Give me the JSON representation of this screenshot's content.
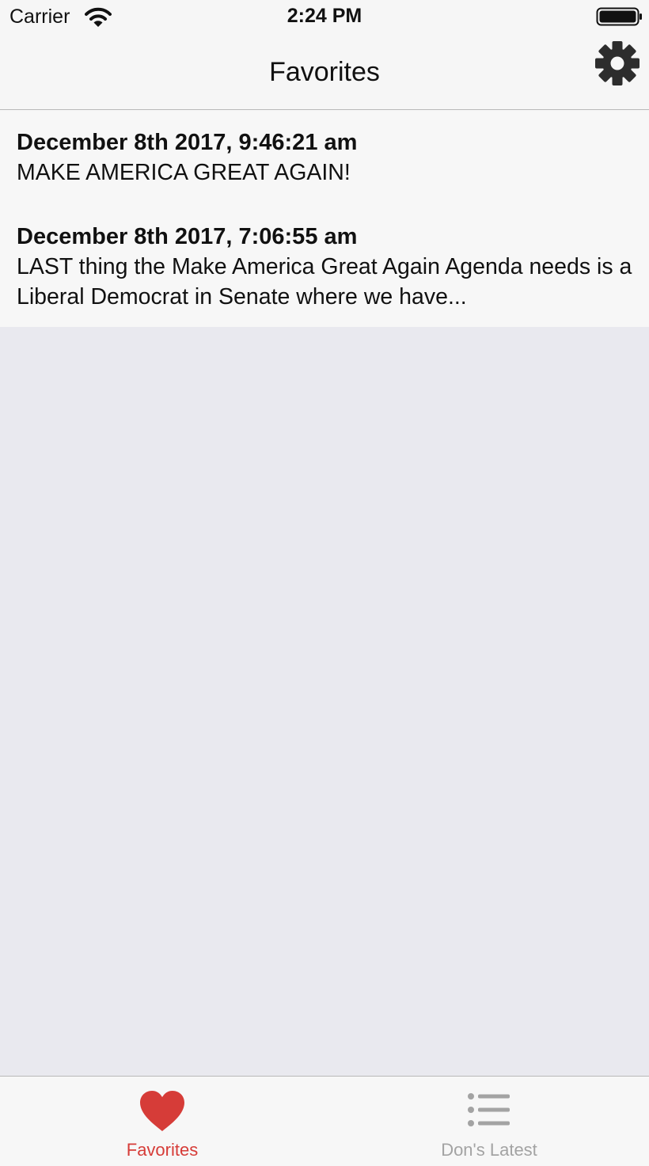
{
  "status_bar": {
    "carrier": "Carrier",
    "time": "2:24 PM",
    "icons": [
      "wifi-icon",
      "battery-icon"
    ]
  },
  "nav": {
    "title": "Favorites",
    "settings_icon": "gear-icon"
  },
  "favorites": [
    {
      "date": "December 8th 2017, 9:46:21 am",
      "text": "MAKE AMERICA GREAT AGAIN!"
    },
    {
      "date": "December 8th 2017, 7:06:55 am",
      "text": "LAST thing the Make America Great Again Agenda needs is a Liberal Democrat in Senate where we have..."
    }
  ],
  "tabs": [
    {
      "label": "Favorites",
      "icon": "heart-icon",
      "active": true
    },
    {
      "label": "Don's Latest",
      "icon": "list-icon",
      "active": false
    }
  ],
  "colors": {
    "accent": "#d63c38",
    "inactive": "#a3a3a3",
    "bar_background": "#f6f6f6",
    "page_background": "#e9e9ef"
  }
}
